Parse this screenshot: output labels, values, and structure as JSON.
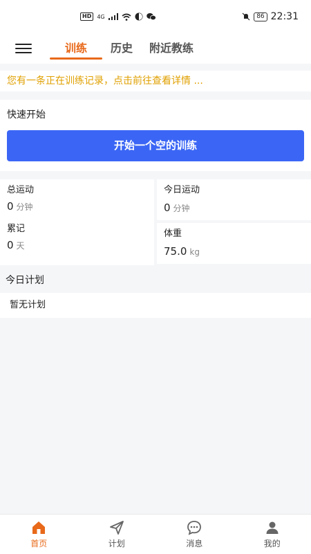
{
  "status_bar": {
    "hd": "HD",
    "network": "4G",
    "battery": "86",
    "time": "22:31"
  },
  "nav": {
    "tabs": [
      {
        "label": "训练",
        "active": true
      },
      {
        "label": "历史",
        "active": false
      },
      {
        "label": "附近教练",
        "active": false
      }
    ]
  },
  "notice": {
    "text": "您有一条正在训练记录，点击前往查看详情 ..."
  },
  "quick_start": {
    "title": "快速开始",
    "button_label": "开始一个空的训练"
  },
  "stats": {
    "total": {
      "label": "总运动",
      "value": "0",
      "unit": "分钟"
    },
    "streak": {
      "label": "累记",
      "value": "0",
      "unit": "天"
    },
    "today": {
      "label": "今日运动",
      "value": "0",
      "unit": "分钟"
    },
    "weight": {
      "label": "体重",
      "value": "75.0",
      "unit": "kg"
    }
  },
  "plan": {
    "title": "今日计划",
    "empty_text": "暂无计划"
  },
  "bottom_nav": {
    "items": [
      {
        "label": "首页",
        "icon": "home-icon",
        "active": true
      },
      {
        "label": "计划",
        "icon": "send-icon",
        "active": false
      },
      {
        "label": "消息",
        "icon": "chat-icon",
        "active": false
      },
      {
        "label": "我的",
        "icon": "user-icon",
        "active": false
      }
    ]
  },
  "colors": {
    "accent": "#e8691a",
    "primary_button": "#3b66f5",
    "notice_text": "#e0a000",
    "background": "#f5f6f8"
  }
}
